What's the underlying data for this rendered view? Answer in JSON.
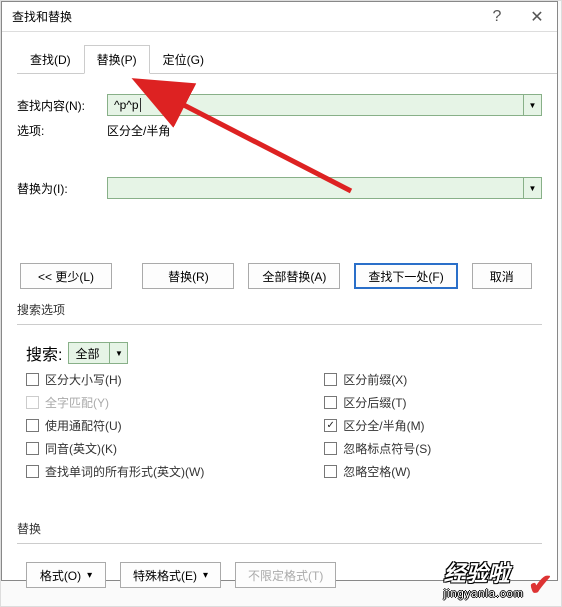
{
  "title": "查找和替换",
  "titlebar": {
    "help_icon": "?",
    "close_icon": "✕"
  },
  "tabs": {
    "find": "查找(D)",
    "replace": "替换(P)",
    "goto": "定位(G)"
  },
  "fields": {
    "find_label": "查找内容(N):",
    "find_value": "^p^p",
    "options_label": "选项:",
    "options_value": "区分全/半角",
    "replace_label": "替换为(I):",
    "replace_value": ""
  },
  "buttons": {
    "less": "<< 更少(L)",
    "replace": "替换(R)",
    "replace_all": "全部替换(A)",
    "find_next": "查找下一处(F)",
    "cancel": "取消"
  },
  "search_group": {
    "title": "搜索选项",
    "search_label": "搜索:",
    "search_value": "全部"
  },
  "checks_left": {
    "case": "区分大小写(H)",
    "whole": "全字匹配(Y)",
    "wildcards": "使用通配符(U)",
    "sounds": "同音(英文)(K)",
    "forms": "查找单词的所有形式(英文)(W)"
  },
  "checks_right": {
    "prefix": "区分前缀(X)",
    "suffix": "区分后缀(T)",
    "width": "区分全/半角(M)",
    "punct": "忽略标点符号(S)",
    "space": "忽略空格(W)"
  },
  "format_group": {
    "title": "替换",
    "format": "格式(O)",
    "special": "特殊格式(E)",
    "noformat": "不限定格式(T)"
  },
  "watermark": {
    "text": "经验啦",
    "url": "jingyanla.com"
  }
}
